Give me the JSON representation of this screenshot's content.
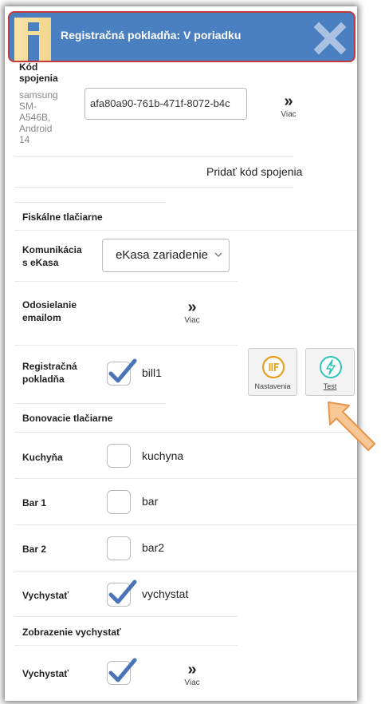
{
  "notification": {
    "title": "Registračná pokladňa: V poriadku",
    "icon": "info-icon",
    "close_icon": "close-icon",
    "colors": {
      "background": "#4a7fc1",
      "border": "#c23a3a",
      "icon_bg": "#f2d58a"
    }
  },
  "connection": {
    "label_top": "Kód",
    "label": "spojenia",
    "device": [
      "samsung",
      "SM-",
      "A546B,",
      "Android",
      "14"
    ],
    "code_value": "afa80a90-761b-471f-8072-b4c",
    "more_label": "Viac"
  },
  "add_code_label": "Pridať kód spojenia",
  "fiscal": {
    "section_title": "Fiskálne tlačiarne",
    "communication_label": [
      "Komunikácia",
      "s eKasa"
    ],
    "communication_value": "eKasa zariadenie",
    "email_label": [
      "Odosielanie",
      "emailom"
    ],
    "email_more": "Viac",
    "register_label": [
      "Registračná",
      "pokladňa"
    ],
    "register_checked": true,
    "register_value": "bill1",
    "settings_label": "Nastavenia",
    "test_label": "Test",
    "colors": {
      "settings_icon": "#e8a020",
      "test_icon": "#2ec4b6"
    }
  },
  "receipt": {
    "section_title": "Bonovacie tlačiarne",
    "rows": [
      {
        "label": "Kuchyňa",
        "checked": false,
        "value": "kuchyna"
      },
      {
        "label": "Bar 1",
        "checked": false,
        "value": "bar"
      },
      {
        "label": "Bar 2",
        "checked": false,
        "value": "bar2"
      },
      {
        "label": "Vychystať",
        "checked": true,
        "value": "vychystat"
      }
    ]
  },
  "display": {
    "section_title": "Zobrazenie vychystať",
    "row_label": "Vychystať",
    "row_checked": true,
    "more_label": "Viac"
  },
  "accent_color": "#4a73b8"
}
